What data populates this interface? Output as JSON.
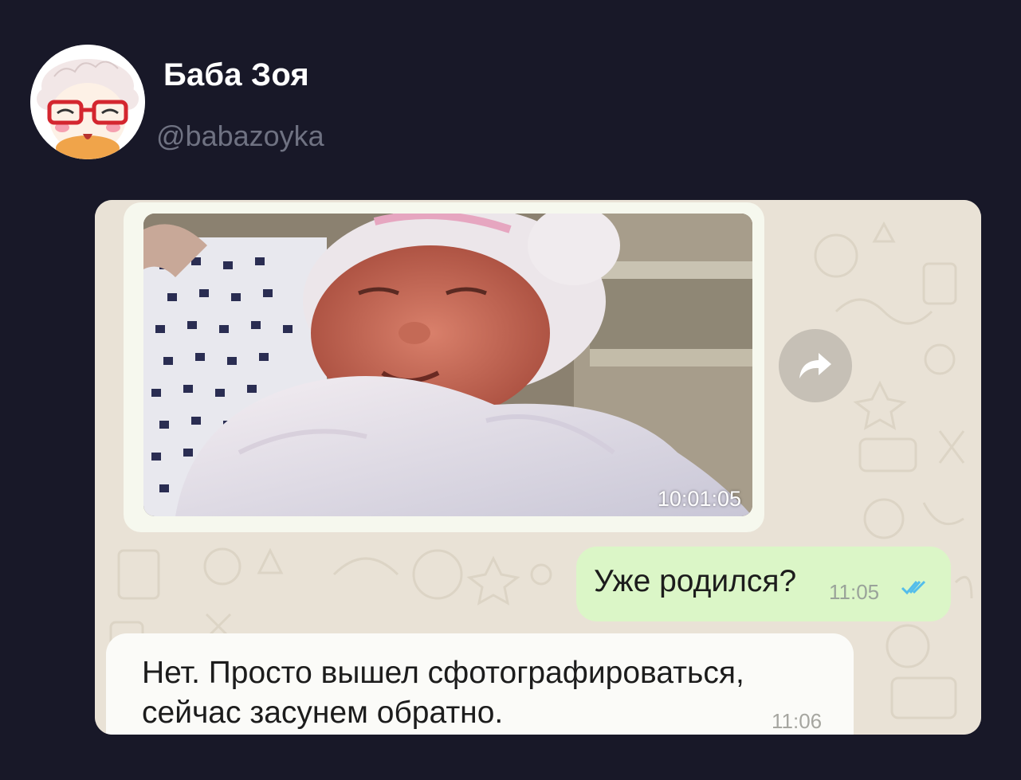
{
  "author": {
    "name": "Баба Зоя",
    "handle": "@babazoyka",
    "avatar_icon": "grandma-cartoon-avatar"
  },
  "chat": {
    "media_message": {
      "time": "10:01:05",
      "content": "newborn-baby-photo"
    },
    "forward_icon": "forward-arrow-icon",
    "outgoing": {
      "text": "Уже родился?",
      "time": "11:05",
      "status_icon": "double-check-icon"
    },
    "incoming": {
      "line1": "Нет. Просто вышел сфотографироваться,",
      "line2": "сейчас засунем обратно.",
      "time": "11:06"
    }
  },
  "colors": {
    "page_background": "#181828",
    "chat_wallpaper": "#e9e2d6",
    "outgoing_bubble": "#dbf6c7",
    "incoming_bubble": "#fbfbf8",
    "read_ticks": "#53bdeb"
  }
}
